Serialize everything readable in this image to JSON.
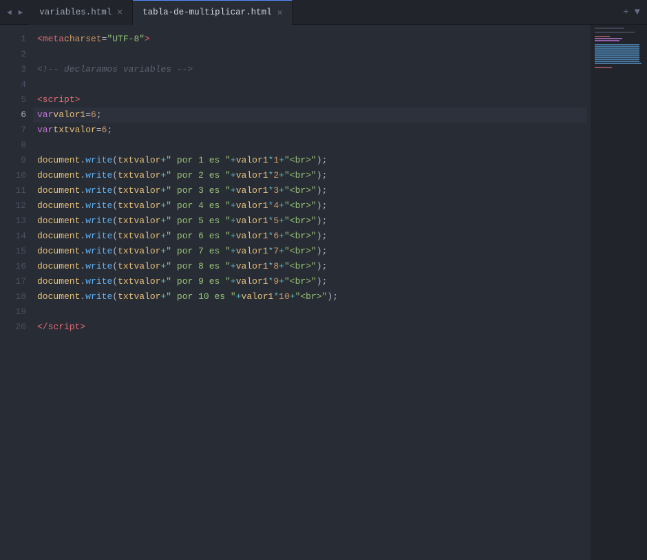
{
  "tabs": [
    {
      "id": "variables",
      "label": "variables.html",
      "active": false
    },
    {
      "id": "tabla",
      "label": "tabla-de-multiplicar.html",
      "active": true
    }
  ],
  "nav_left": [
    "◀",
    "▶"
  ],
  "nav_right": [
    "+",
    "▼"
  ],
  "lines": [
    {
      "num": 1,
      "active": false
    },
    {
      "num": 2,
      "active": false
    },
    {
      "num": 3,
      "active": false
    },
    {
      "num": 4,
      "active": false
    },
    {
      "num": 5,
      "active": false
    },
    {
      "num": 6,
      "active": true
    },
    {
      "num": 7,
      "active": false
    },
    {
      "num": 8,
      "active": false
    },
    {
      "num": 9,
      "active": false
    },
    {
      "num": 10,
      "active": false
    },
    {
      "num": 11,
      "active": false
    },
    {
      "num": 12,
      "active": false
    },
    {
      "num": 13,
      "active": false
    },
    {
      "num": 14,
      "active": false
    },
    {
      "num": 15,
      "active": false
    },
    {
      "num": 16,
      "active": false
    },
    {
      "num": 17,
      "active": false
    },
    {
      "num": 18,
      "active": false
    },
    {
      "num": 19,
      "active": false
    },
    {
      "num": 20,
      "active": false
    }
  ]
}
